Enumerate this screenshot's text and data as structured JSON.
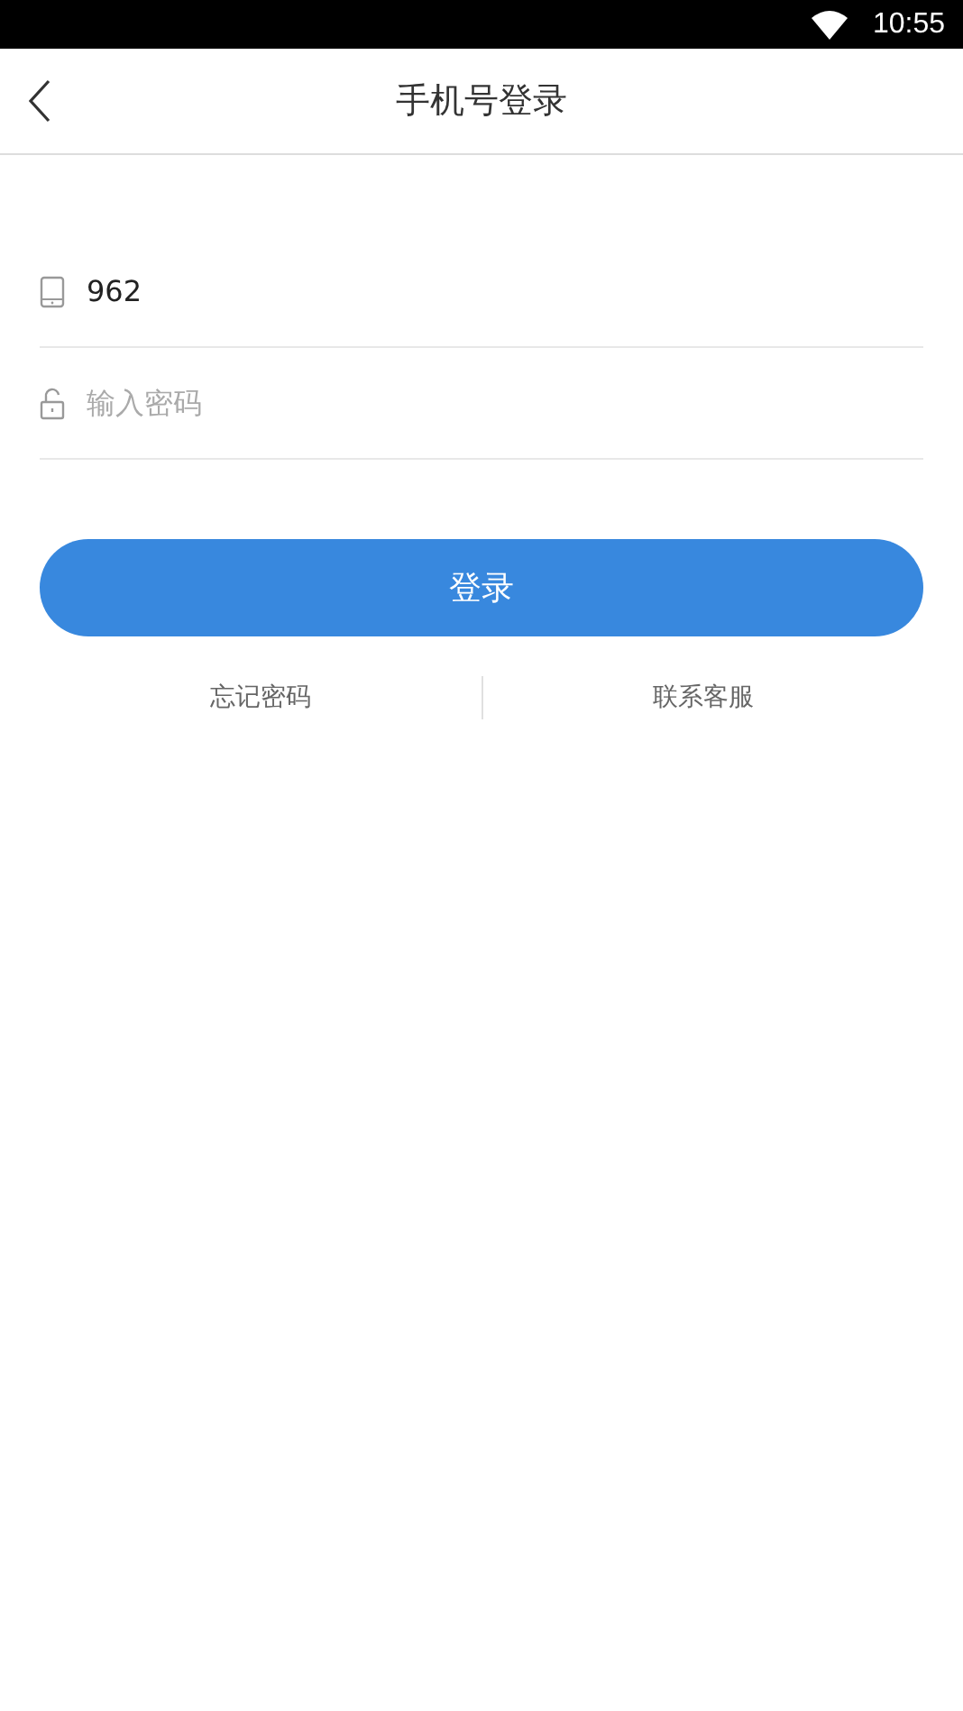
{
  "status_bar": {
    "time": "10:55"
  },
  "header": {
    "title": "手机号登录"
  },
  "fields": [
    {
      "kind": "phone",
      "value": "962"
    },
    {
      "kind": "password",
      "placeholder": "输入密码"
    }
  ],
  "login_button": {
    "label": "登录"
  },
  "links": [
    "忘记密码",
    "联系客服"
  ]
}
